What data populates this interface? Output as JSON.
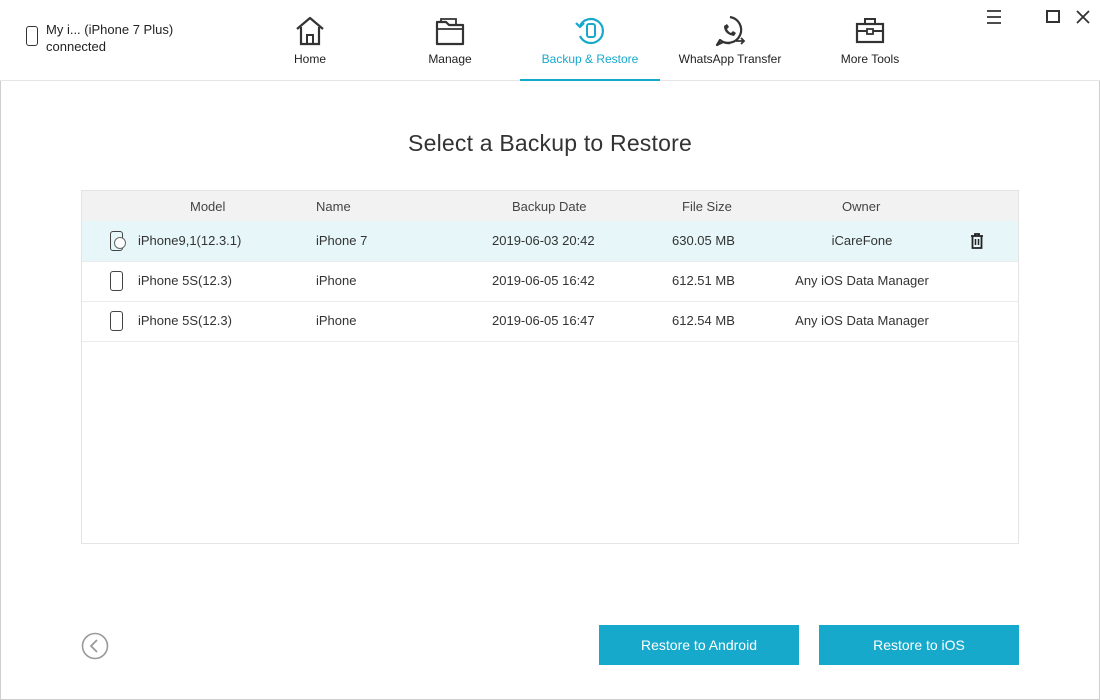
{
  "device": {
    "name": "My i... (iPhone 7 Plus)",
    "status": "connected"
  },
  "nav": {
    "tabs": [
      {
        "label": "Home",
        "icon": "home-icon"
      },
      {
        "label": "Manage",
        "icon": "folder-icon"
      },
      {
        "label": "Backup & Restore",
        "icon": "backup-restore-icon",
        "active": true
      },
      {
        "label": "WhatsApp Transfer",
        "icon": "whatsapp-icon"
      },
      {
        "label": "More Tools",
        "icon": "toolbox-icon"
      }
    ]
  },
  "window_controls": [
    "menu-icon",
    "maximize-icon",
    "close-icon"
  ],
  "main": {
    "title": "Select a Backup to Restore"
  },
  "table": {
    "columns": [
      "Model",
      "Name",
      "Backup Date",
      "File Size",
      "Owner"
    ],
    "rows": [
      {
        "model": "iPhone9,1(12.3.1)",
        "name": "iPhone 7",
        "date": "2019-06-03 20:42",
        "size": "630.05 MB",
        "owner": "iCareFone",
        "selected": true
      },
      {
        "model": "iPhone 5S(12.3)",
        "name": "iPhone",
        "date": "2019-06-05 16:42",
        "size": "612.51 MB",
        "owner": "Any iOS Data Manager"
      },
      {
        "model": "iPhone 5S(12.3)",
        "name": "iPhone",
        "date": "2019-06-05 16:47",
        "size": "612.54 MB",
        "owner": "Any iOS Data Manager"
      }
    ]
  },
  "footer": {
    "restore_android": "Restore to Android",
    "restore_ios": "Restore to iOS"
  },
  "colors": {
    "accent": "#17a9cc",
    "selected_row": "#e6f6f9"
  }
}
